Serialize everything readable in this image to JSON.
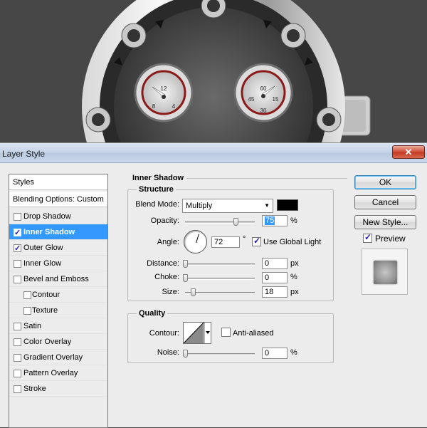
{
  "gauges": {
    "left": {
      "n12": "12",
      "n9": "8",
      "n3": "4"
    },
    "right": {
      "n12": "60",
      "n9": "45",
      "n3": "15",
      "n6": "30"
    }
  },
  "dialog": {
    "title": "Layer Style",
    "close_glyph": "✕"
  },
  "styles_list": {
    "header": "Styles",
    "blending": "Blending Options: Custom",
    "items": [
      {
        "label": "Drop Shadow",
        "checked": false,
        "sub": false,
        "active": false
      },
      {
        "label": "Inner Shadow",
        "checked": true,
        "sub": false,
        "active": true
      },
      {
        "label": "Outer Glow",
        "checked": true,
        "sub": false,
        "active": false
      },
      {
        "label": "Inner Glow",
        "checked": false,
        "sub": false,
        "active": false
      },
      {
        "label": "Bevel and Emboss",
        "checked": false,
        "sub": false,
        "active": false
      },
      {
        "label": "Contour",
        "checked": false,
        "sub": true,
        "active": false
      },
      {
        "label": "Texture",
        "checked": false,
        "sub": true,
        "active": false
      },
      {
        "label": "Satin",
        "checked": false,
        "sub": false,
        "active": false
      },
      {
        "label": "Color Overlay",
        "checked": false,
        "sub": false,
        "active": false
      },
      {
        "label": "Gradient Overlay",
        "checked": false,
        "sub": false,
        "active": false
      },
      {
        "label": "Pattern Overlay",
        "checked": false,
        "sub": false,
        "active": false
      },
      {
        "label": "Stroke",
        "checked": false,
        "sub": false,
        "active": false
      }
    ]
  },
  "panel": {
    "section_title": "Inner Shadow",
    "structure": {
      "title": "Structure",
      "blend_mode_label": "Blend Mode:",
      "blend_mode_value": "Multiply",
      "color": "#000000",
      "opacity_label": "Opacity:",
      "opacity_value": "75",
      "opacity_unit": "%",
      "opacity_level": 0.75,
      "angle_label": "Angle:",
      "angle_value": "72",
      "angle_unit": "°",
      "global_light_label": "Use Global Light",
      "distance_label": "Distance:",
      "distance_value": "0",
      "distance_unit": "px",
      "choke_label": "Choke:",
      "choke_value": "0",
      "choke_unit": "%",
      "size_label": "Size:",
      "size_value": "18",
      "size_unit": "px"
    },
    "quality": {
      "title": "Quality",
      "contour_label": "Contour:",
      "anti_aliased_label": "Anti-aliased",
      "noise_label": "Noise:",
      "noise_value": "0",
      "noise_unit": "%"
    }
  },
  "buttons": {
    "ok": "OK",
    "cancel": "Cancel",
    "new_style": "New Style...",
    "preview_label": "Preview"
  }
}
